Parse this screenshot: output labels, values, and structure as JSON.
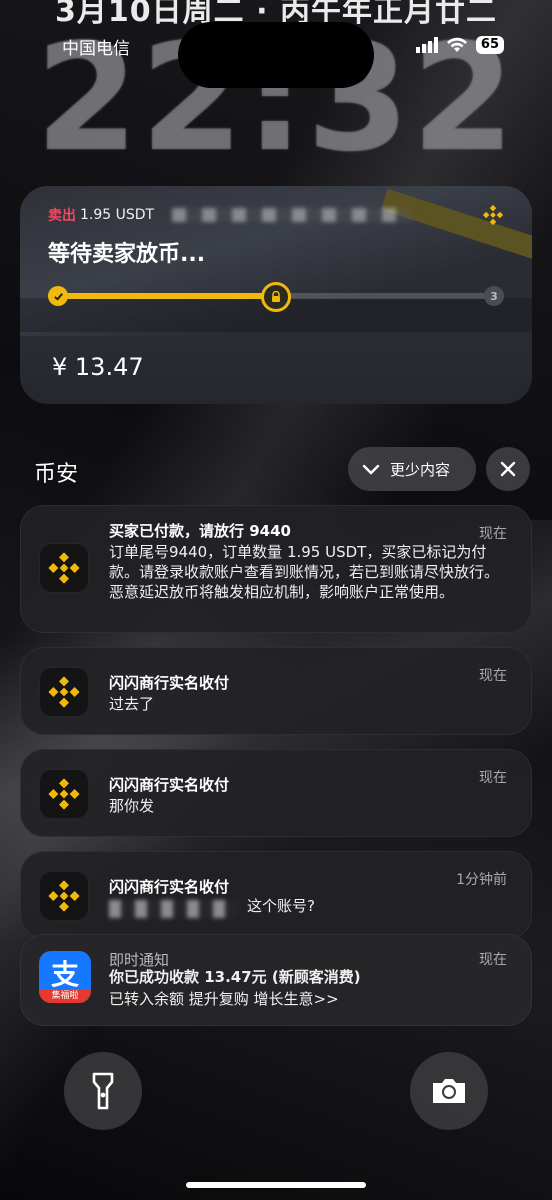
{
  "date_line": "3月10日周二 · 丙午年正月廿二",
  "clock": "22:32",
  "status": {
    "carrier": "中国电信",
    "battery": "65"
  },
  "live_activity": {
    "side": "卖出",
    "amount": "1.95 USDT",
    "status_title": "等待卖家放币...",
    "step_current": "2",
    "step_last": "3",
    "progress": 0.52,
    "price": "¥ 13.47",
    "logo_icon": "binance-logo-icon"
  },
  "group": {
    "title": "币安",
    "show_less": "更少内容"
  },
  "notifications": [
    {
      "title": "买家已付款，请放行 9440",
      "body": "订单尾号9440，订单数量 1.95 USDT，买家已标记为付款。请登录收款账户查看到账情况，若已到账请尽快放行。恶意延迟放币将触发相应机制，影响账户正常使用。",
      "time": "现在",
      "icon": "binance-app-icon"
    },
    {
      "title": "闪闪商行实名收付",
      "body": "过去了",
      "time": "现在",
      "icon": "binance-app-icon"
    },
    {
      "title": "闪闪商行实名收付",
      "body": "那你发",
      "time": "现在",
      "icon": "binance-app-icon"
    },
    {
      "title": "闪闪商行实名收付",
      "body": "这个账号?",
      "time": "1分钟前",
      "icon": "binance-app-icon"
    }
  ],
  "alipay": {
    "title": "即时通知",
    "line1": "你已成功收款 13.47元 (新顾客消费)",
    "line2": "已转入余额 提升复购 增长生意>>",
    "time": "现在",
    "icon_glyph": "支",
    "icon_band": "集福啦"
  },
  "bottom": {
    "left_icon": "flashlight-icon",
    "right_icon": "camera-icon"
  },
  "colors": {
    "binance_yellow": "#F0B90B",
    "sell_red": "#F6465D",
    "alipay_blue": "#1677FF"
  }
}
